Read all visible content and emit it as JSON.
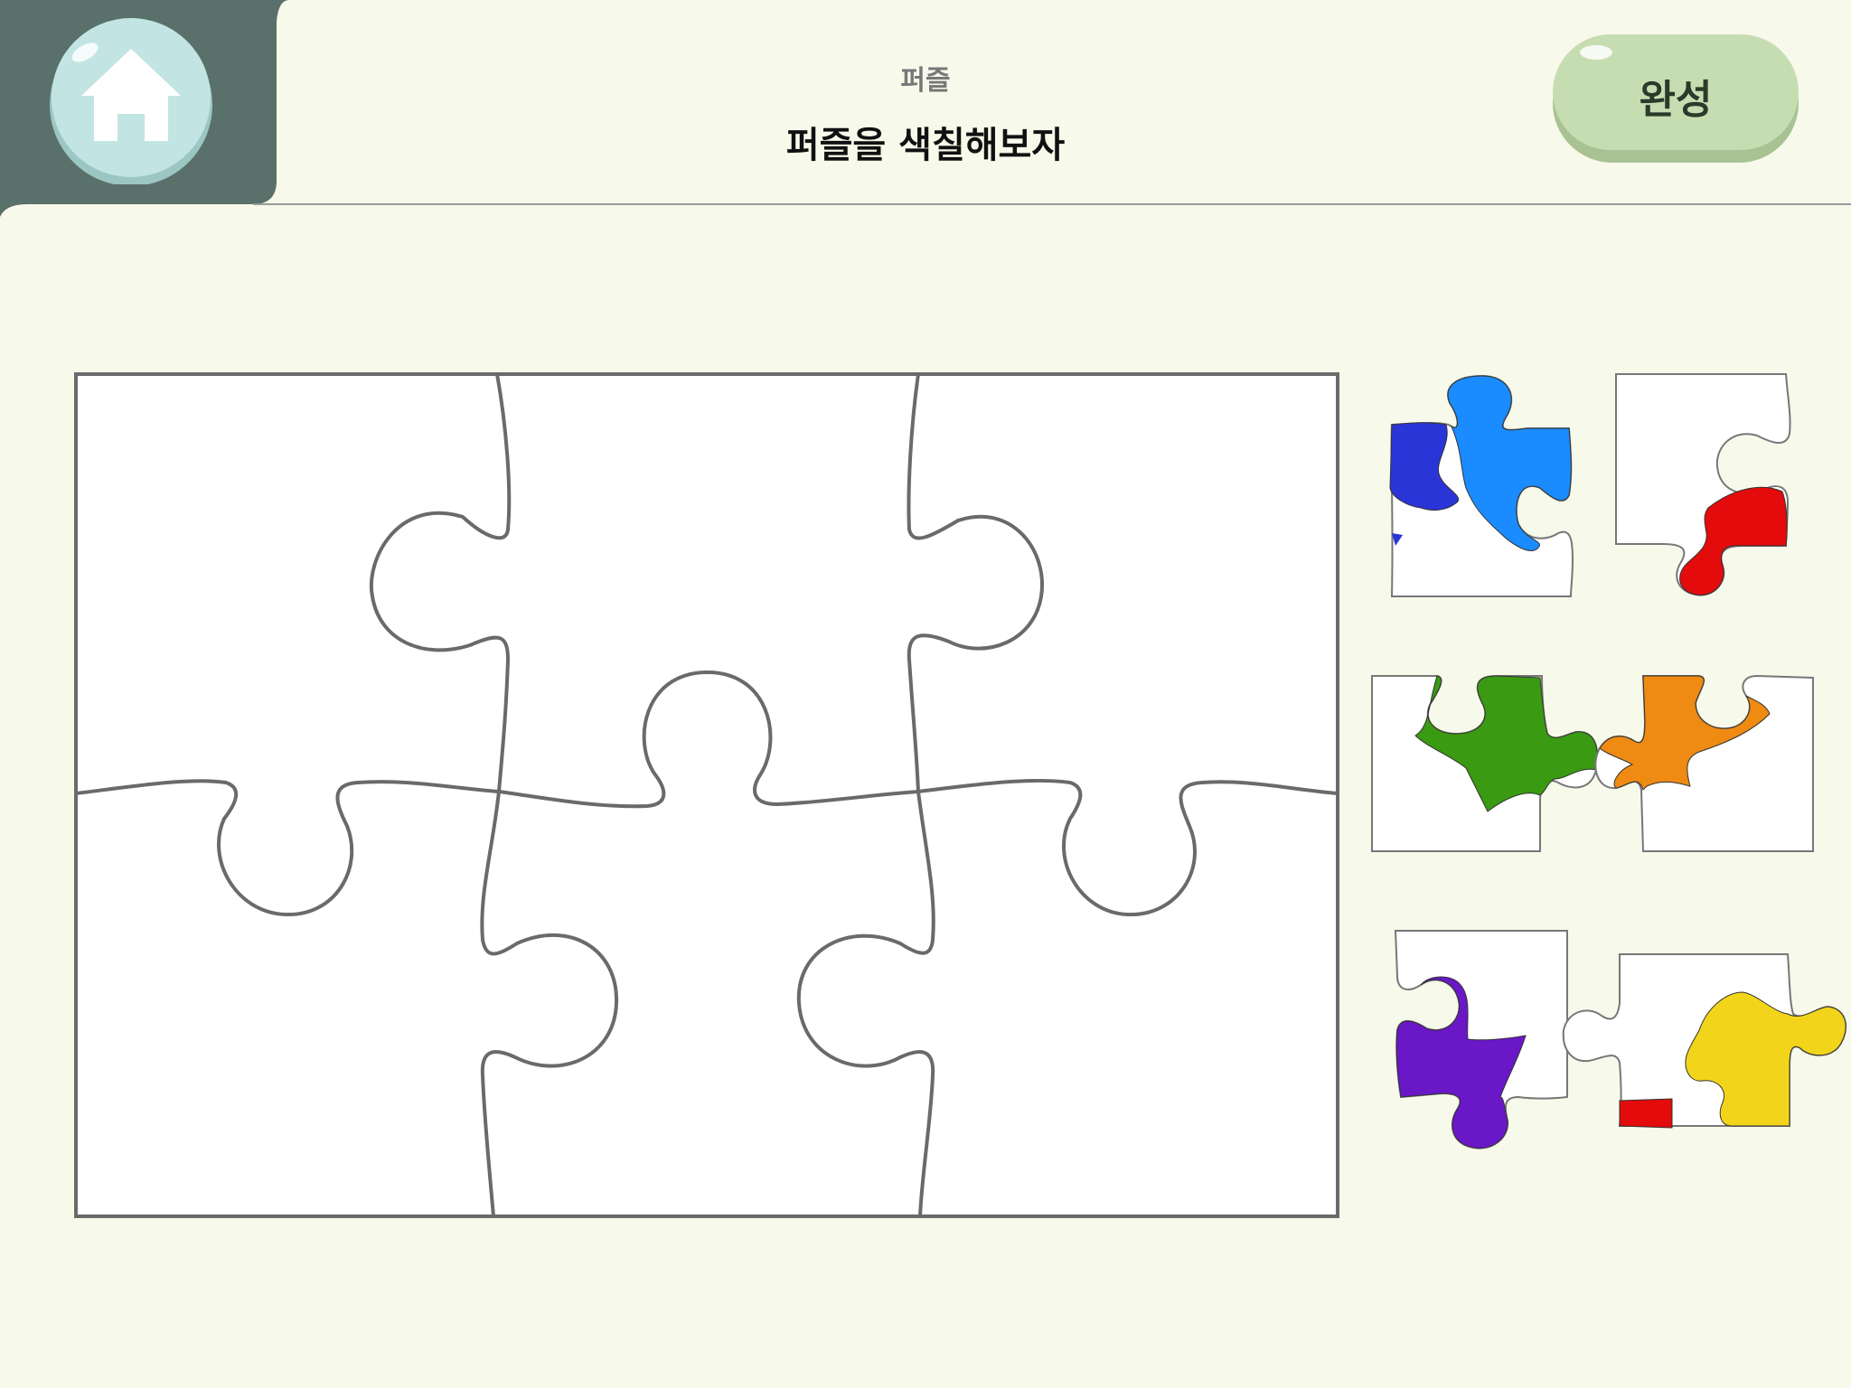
{
  "header": {
    "subtitle": "퍼즐",
    "title": "퍼즐을 색칠해보자",
    "complete_label": "완성"
  },
  "icons": {
    "home": "home-icon"
  },
  "colors": {
    "background": "#f7f9ea",
    "header_tab": "#5a706a",
    "home_button": "#bfe3e1",
    "complete_button": "#c5ddb0",
    "piece_outline": "#666666",
    "blue_dark": "#2a35d8",
    "blue_light": "#1a8cff",
    "red": "#e30b0b",
    "green": "#3a9a12",
    "orange": "#ef8a12",
    "purple": "#6a17c8",
    "yellow": "#f2d51a"
  },
  "board": {
    "rows": 2,
    "columns": 3,
    "piece_count": 6
  },
  "tray": {
    "pieces": [
      {
        "name": "tray-piece-1",
        "fills": [
          "blue_dark",
          "blue_light"
        ]
      },
      {
        "name": "tray-piece-2",
        "fills": [
          "red"
        ]
      },
      {
        "name": "tray-piece-3",
        "fills": [
          "green"
        ]
      },
      {
        "name": "tray-piece-4",
        "fills": [
          "orange"
        ]
      },
      {
        "name": "tray-piece-5",
        "fills": [
          "purple"
        ]
      },
      {
        "name": "tray-piece-6",
        "fills": [
          "red",
          "yellow"
        ]
      }
    ]
  }
}
